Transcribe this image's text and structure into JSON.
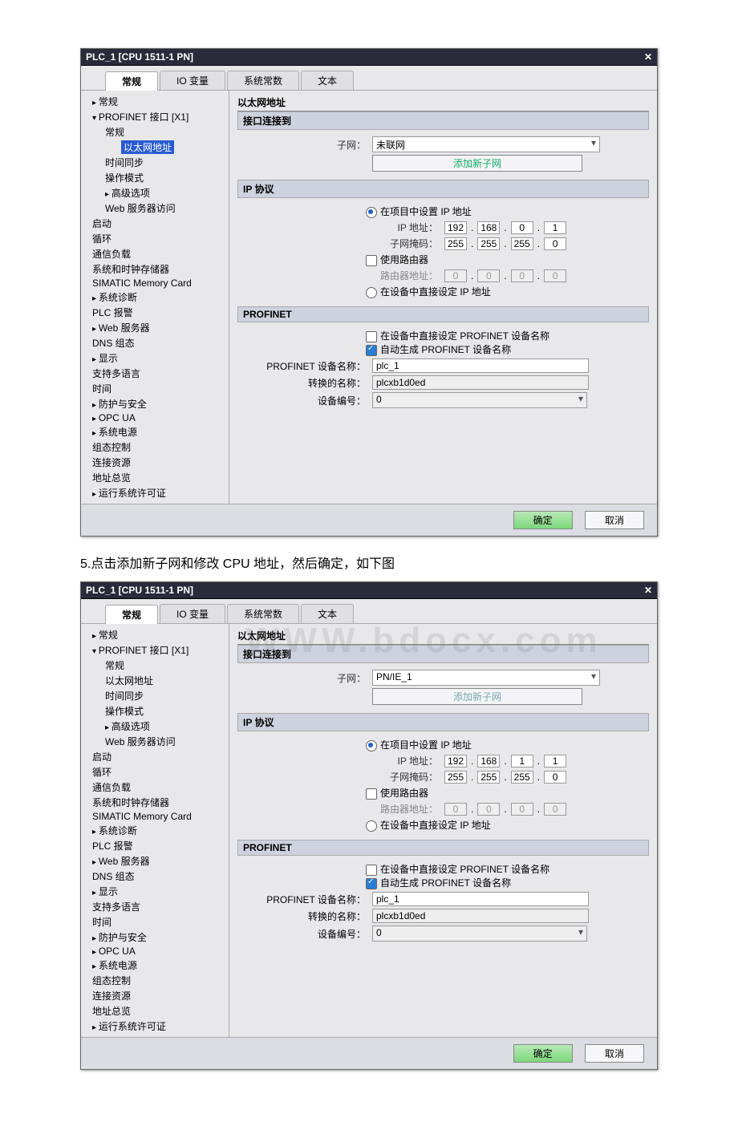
{
  "title": "PLC_1 [CPU 1511-1 PN]",
  "tabs": [
    "常规",
    "IO 变量",
    "系统常数",
    "文本"
  ],
  "tree": {
    "general": "常规",
    "profinet": "PROFINET 接口 [X1]",
    "sub_general": "常规",
    "eth_addr": "以太网地址",
    "time_sync": "时间同步",
    "op_mode": "操作模式",
    "adv_opt": "高级选项",
    "web_access": "Web 服务器访问",
    "startup": "启动",
    "cycle": "循环",
    "comm_load": "通信负载",
    "sys_clock": "系统和时钟存储器",
    "smc": "SIMATIC Memory Card",
    "sys_diag": "系统诊断",
    "plc_alarm": "PLC 报警",
    "web_srv": "Web 服务器",
    "dns": "DNS 组态",
    "display": "显示",
    "multilang": "支持多语言",
    "time": "时间",
    "security": "防护与安全",
    "opcua": "OPC UA",
    "power": "系统电源",
    "cfg_ctrl": "组态控制",
    "conn_res": "连接资源",
    "addr_ov": "地址总览",
    "runtime": "运行系统许可证"
  },
  "content": {
    "eth_header": "以太网地址",
    "iface_connect": "接口连接到",
    "subnet_lbl": "子网：",
    "add_subnet": "添加新子网",
    "ip_proto": "IP 协议",
    "set_in_proj": "在项目中设置 IP 地址",
    "ip_addr_lbl": "IP 地址：",
    "mask_lbl": "子网掩码：",
    "use_router": "使用路由器",
    "router_lbl": "路由器地址：",
    "set_in_dev": "在设备中直接设定 IP 地址",
    "profinet": "PROFINET",
    "set_name_dev": "在设备中直接设定 PROFINET 设备名称",
    "auto_name": "自动生成 PROFINET 设备名称",
    "dev_name_lbl": "PROFINET 设备名称：",
    "conv_name_lbl": "转换的名称：",
    "dev_num_lbl": "设备编号：",
    "dev_name": "plc_1",
    "conv_name": "plcxb1d0ed",
    "dev_num": "0"
  },
  "d1": {
    "subnet": "未联网",
    "ip": [
      "192",
      "168",
      "0",
      "1"
    ],
    "mask": [
      "255",
      "255",
      "255",
      "0"
    ],
    "router": [
      "0",
      "0",
      "0",
      "0"
    ]
  },
  "d2": {
    "subnet": "PN/IE_1",
    "ip": [
      "192",
      "168",
      "1",
      "1"
    ],
    "mask": [
      "255",
      "255",
      "255",
      "0"
    ],
    "router": [
      "0",
      "0",
      "0",
      "0"
    ]
  },
  "step_text": "5.点击添加新子网和修改 CPU 地址，然后确定，如下图",
  "watermark": "WWW.bdocx.com",
  "buttons": {
    "ok": "确定",
    "cancel": "取消"
  }
}
